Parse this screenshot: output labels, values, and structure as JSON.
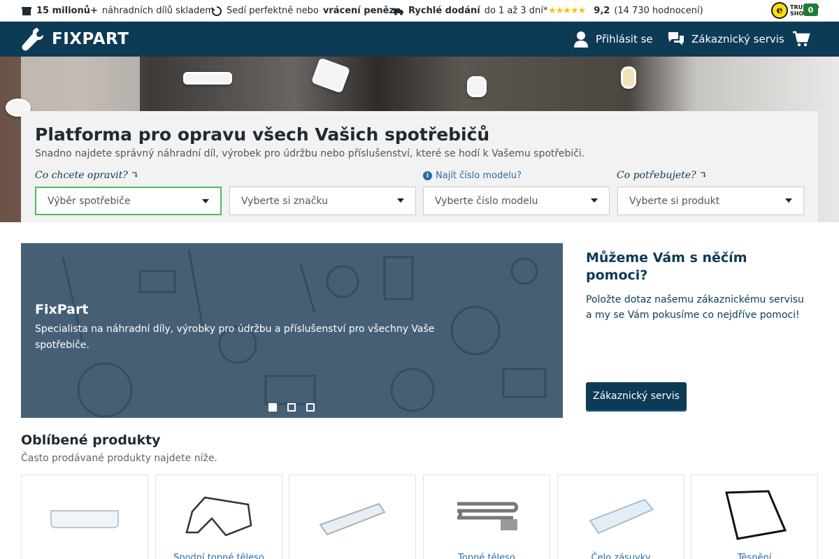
{
  "usp": {
    "stock_bold": "15 milionů+",
    "stock_text": "náhradních dílů skladem",
    "fit_text1": "Sedí perfektně nebo",
    "fit_bold": "vrácení peněz",
    "delivery_bold": "Rychlé dodání",
    "delivery_text": "do 1 až 3 dní*",
    "stars": "★★★★★",
    "rating_value": "9,2",
    "rating_count": "(14 730 hodnocení)",
    "trusted_line1": "TRUSTED",
    "trusted_line2": "SHOPS",
    "trusted_seal": "e"
  },
  "nav": {
    "logo_text": "FIXPART",
    "login_label": "Přihlásit se",
    "service_label": "Zákaznický servis",
    "cart_count": "0"
  },
  "hero": {
    "title": "Platforma pro opravu všech Vašich spotřebičů",
    "subtitle": "Snadno najdete správný náhradní díl, výrobek pro údržbu nebo příslušenství, které se hodí k Vašemu spotřebiči.",
    "label_repair": "Co chcete opravit?",
    "label_model_help": "Najít číslo modelu?",
    "label_need": "Co potřebujete?",
    "select_appliance": "Výběr spotřebiče",
    "select_brand": "Vyberte si značku",
    "select_model": "Vyberte číslo modelu",
    "select_product": "Vyberte si produkt"
  },
  "banner": {
    "title": "FixPart",
    "text": "Specialista na náhradní díly, výrobky pro údržbu a příslušenství pro všechny Vaše spotřebiče.",
    "active_slide": 1,
    "slide_count": 3
  },
  "help": {
    "title": "Můžeme Vám s něčím pomoci?",
    "text": "Položte dotaz našemu zákaznickému servisu a my se Vám pokusíme co nejdříve pomoci!",
    "button": "Zákaznický servis"
  },
  "popular": {
    "title": "Oblíbené produkty",
    "subtitle": "Často prodávané produkty najdete níže.",
    "products": [
      {
        "name": ""
      },
      {
        "name": "Spodní topné těleso"
      },
      {
        "name": ""
      },
      {
        "name": "Topné těleso"
      },
      {
        "name": "Čelo zásuvky"
      },
      {
        "name": "Těsnění"
      }
    ]
  },
  "colors": {
    "brand_navy": "#0d3a55",
    "accent_green": "#4cbb57",
    "link_blue": "#2a6aa8",
    "star_yellow": "#f5c400"
  }
}
